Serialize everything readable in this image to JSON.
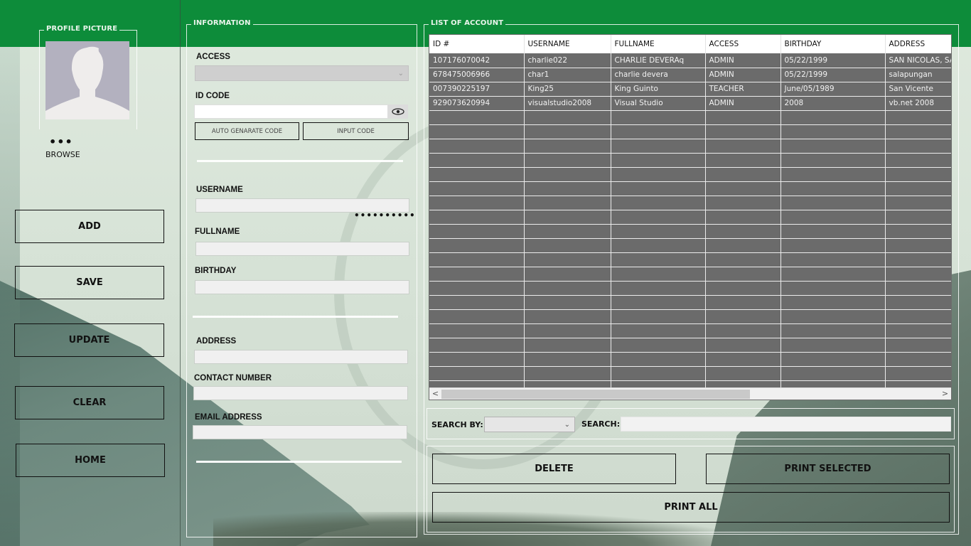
{
  "colors": {
    "header_green": "#0d8c3a",
    "grid_background": "#6b6b6b",
    "grid_header": "#ffffff"
  },
  "profile": {
    "title": "PROFILE PICTURE",
    "browse_dots": "•••",
    "browse_label": "BROWSE",
    "placeholder_icon": "user-silhouette-icon"
  },
  "actions": {
    "add": "ADD",
    "save": "SAVE",
    "update": "UPDATE",
    "clear": "CLEAR",
    "home": "HOME"
  },
  "information": {
    "title": "INFORMATION",
    "access_label": "ACCESS",
    "access_value": "",
    "id_code_label": "ID CODE",
    "id_code_value": "",
    "eye_icon": "eye-icon",
    "auto_generate_label": "AUTO GENARATE CODE",
    "input_code_label": "INPUT CODE",
    "username_label": "USERNAME",
    "username_value": "",
    "password_mask": "••••••••••",
    "fullname_label": "FULLNAME",
    "fullname_value": "",
    "birthday_label": "BIRTHDAY",
    "birthday_value": "",
    "address_label": "ADDRESS",
    "address_value": "",
    "contact_label": "CONTACT NUMBER",
    "contact_value": "",
    "email_label": "EMAIL ADDRESS",
    "email_value": ""
  },
  "accounts": {
    "title": "LIST OF ACCOUNT",
    "columns": [
      "ID #",
      "USERNAME",
      "FULLNAME",
      "ACCESS",
      "BIRTHDAY",
      "ADDRESS"
    ],
    "rows": [
      [
        "107176070042",
        "charlie022",
        "CHARLIE DEVERAq",
        "ADMIN",
        "05/22/1999",
        "SAN NICOLAS, SA"
      ],
      [
        "678475006966",
        "char1",
        "charlie devera",
        "ADMIN",
        "05/22/1999",
        "salapungan"
      ],
      [
        "007390225197",
        "King25",
        "King Guinto",
        "TEACHER",
        "June/05/1989",
        "San Vicente"
      ],
      [
        "929073620994",
        "visualstudio2008",
        "Visual Studio",
        "ADMIN",
        "2008",
        "vb.net 2008"
      ]
    ],
    "empty_rows": 20,
    "scroll_left": "<",
    "scroll_right": ">",
    "scroll_fraction_visible": 0.62
  },
  "search": {
    "search_by_label": "SEARCH BY:",
    "search_by_value": "",
    "search_label": "SEARCH:",
    "search_value": ""
  },
  "bottom_actions": {
    "delete": "DELETE",
    "print_selected": "PRINT SELECTED",
    "print_all": "PRINT ALL"
  }
}
